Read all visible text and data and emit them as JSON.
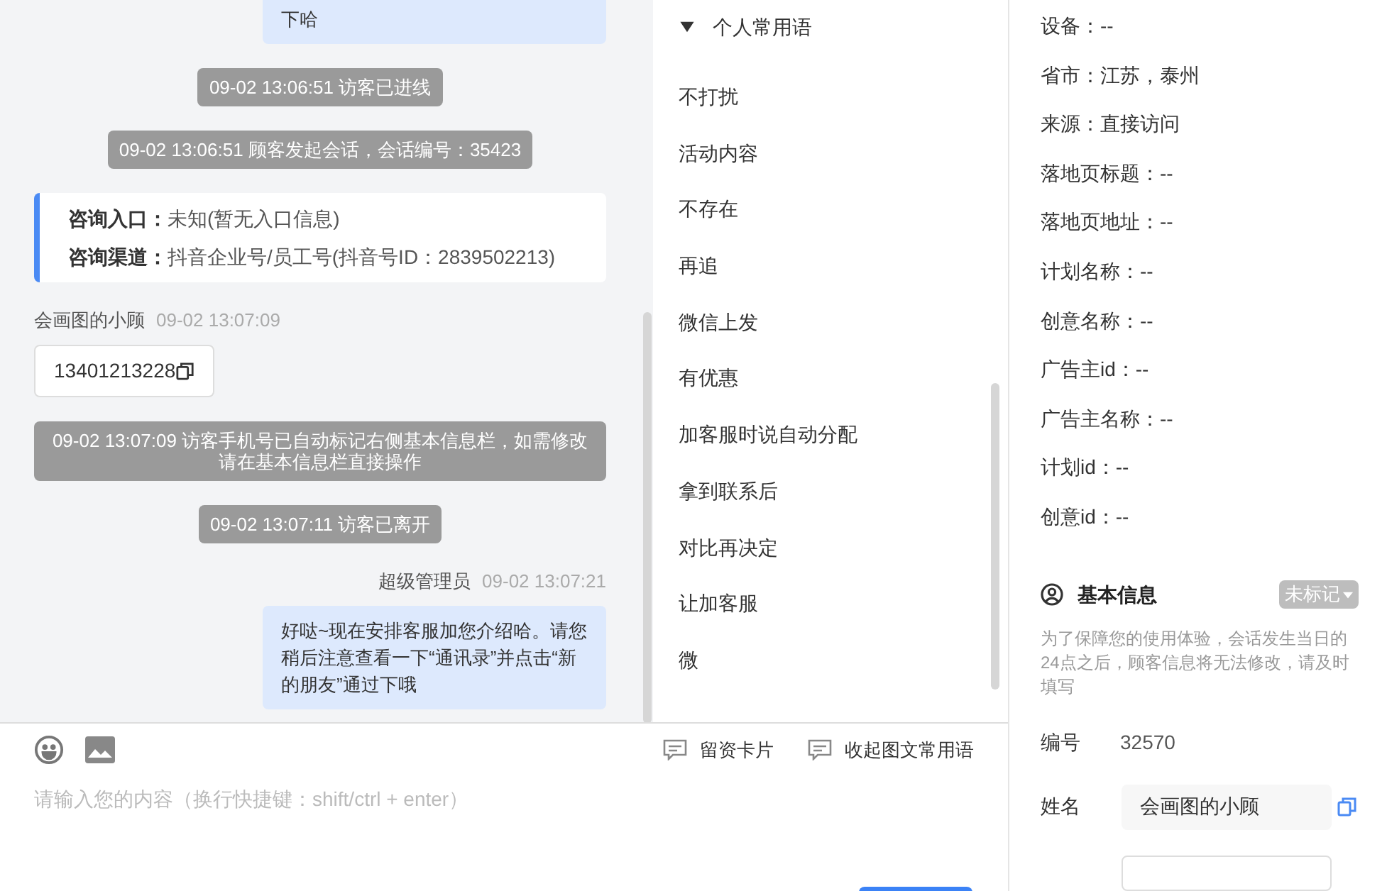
{
  "chat": {
    "messages": [
      {
        "kind": "agent",
        "text": "下哈"
      },
      {
        "kind": "system",
        "text": "09-02 13:06:51 访客已进线"
      },
      {
        "kind": "system",
        "text": "09-02 13:06:51 顾客发起会话，会话编号：35423"
      },
      {
        "kind": "info_card",
        "rows": [
          {
            "label": "咨询入口：",
            "value": "未知(暂无入口信息)"
          },
          {
            "label": "咨询渠道：",
            "value": "抖音企业号/员工号(抖音号ID：2839502213)"
          }
        ]
      },
      {
        "kind": "visitor",
        "sender": "会画图的小顾",
        "time": "09-02 13:07:09",
        "text": "13401213228"
      },
      {
        "kind": "system",
        "text": "09-02 13:07:09 访客手机号已自动标记右侧基本信息栏，如需修改请在基本信息栏直接操作"
      },
      {
        "kind": "system",
        "text": "09-02 13:07:11 访客已离开"
      },
      {
        "kind": "agent",
        "sender": "超级管理员",
        "time": "09-02 13:07:21",
        "text": "好哒~现在安排客服加您介绍哈。请您稍后注意查看一下“通讯录”并点击“新的朋友”通过下哦"
      }
    ]
  },
  "phrases": {
    "title": "个人常用语",
    "expanded": true,
    "items": [
      "不打扰",
      "活动内容",
      "不存在",
      "再追",
      "微信上发",
      "有优惠",
      "加客服时说自动分配",
      "拿到联系后",
      "对比再决定",
      "让加客服",
      "微"
    ]
  },
  "composer": {
    "actions": [
      "留资卡片",
      "收起图文常用语"
    ],
    "placeholder": "请输入您的内容（换行快捷键：shift/ctrl + enter）"
  },
  "visitor_info": {
    "fields": [
      "设备：--",
      "省市：江苏，泰州",
      "来源：直接访问",
      "落地页标题：--",
      "落地页地址：--",
      "计划名称：--",
      "创意名称：--",
      "广告主id：--",
      "广告主名称：--",
      "计划id：--",
      "创意id：--"
    ]
  },
  "basic_info": {
    "title": "基本信息",
    "tag": "未标记",
    "note": "为了保障您的使用体验，会话发生当日的24点之后，顾客信息将无法修改，请及时填写",
    "id_label": "编号",
    "id_value": "32570",
    "name_label": "姓名",
    "name_value": "会画图的小顾"
  }
}
